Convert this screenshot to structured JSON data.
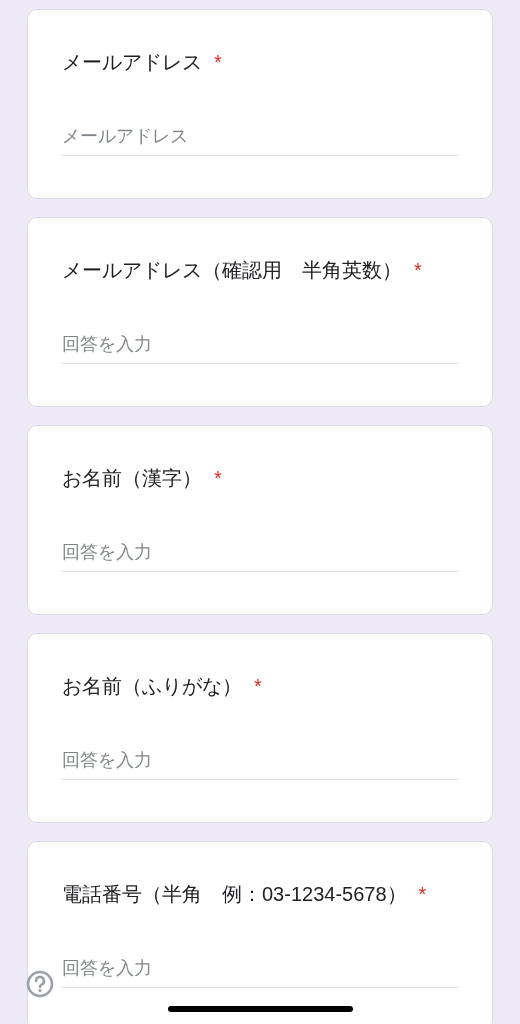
{
  "required_mark": "*",
  "questions": [
    {
      "title": "メールアドレス",
      "required": true,
      "placeholder": "メールアドレス"
    },
    {
      "title": "メールアドレス（確認用　半角英数）",
      "required": true,
      "placeholder": "回答を入力"
    },
    {
      "title": "お名前（漢字）",
      "required": true,
      "placeholder": "回答を入力"
    },
    {
      "title": "お名前（ふりがな）",
      "required": true,
      "placeholder": "回答を入力"
    },
    {
      "title": "電話番号（半角　例：03-1234-5678）",
      "required": true,
      "placeholder": "回答を入力"
    }
  ]
}
